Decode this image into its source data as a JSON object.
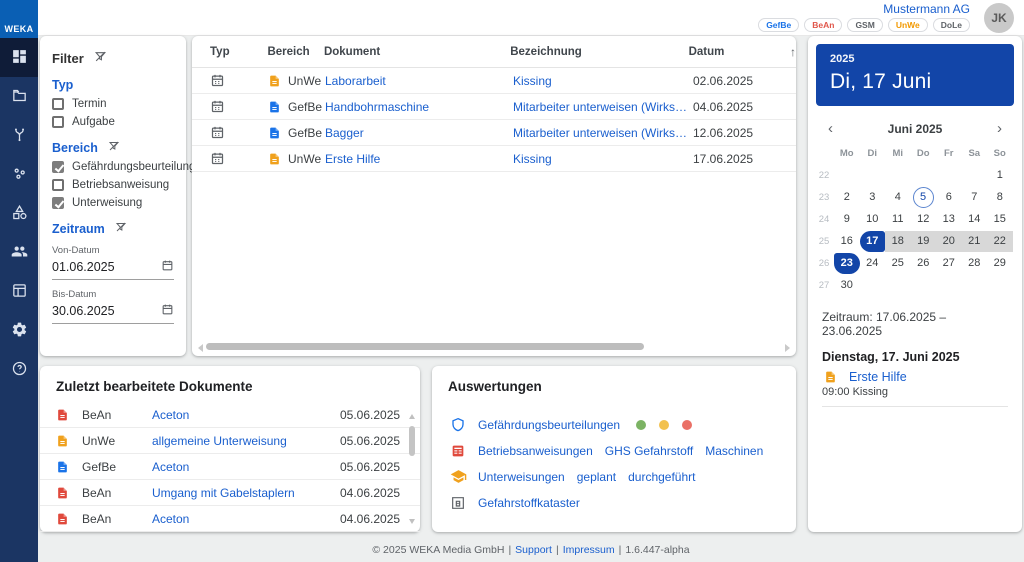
{
  "brand": {
    "logo_text": "WEKA"
  },
  "topbar": {
    "company": "Mustermann AG",
    "avatar_initials": "JK",
    "badges": [
      {
        "label": "GefBe",
        "color": "#1a73e8"
      },
      {
        "label": "BeAn",
        "color": "#e0564a"
      },
      {
        "label": "GSM",
        "color": "#5f6368"
      },
      {
        "label": "UnWe",
        "color": "#f29900"
      },
      {
        "label": "DoLe",
        "color": "#5f6368"
      }
    ]
  },
  "sidebar": {
    "icons": [
      "dashboard",
      "documents",
      "workflow",
      "substances",
      "categories",
      "team",
      "planner",
      "settings",
      "help"
    ],
    "active": "dashboard"
  },
  "filter": {
    "title": "Filter",
    "typ": {
      "label": "Typ",
      "options": [
        {
          "label": "Termin",
          "checked": false
        },
        {
          "label": "Aufgabe",
          "checked": false
        }
      ]
    },
    "bereich": {
      "label": "Bereich",
      "options": [
        {
          "label": "Gefährdungsbeurteilung",
          "checked": true
        },
        {
          "label": "Betriebsanweisung",
          "checked": false
        },
        {
          "label": "Unterweisung",
          "checked": true
        }
      ]
    },
    "zeitraum": {
      "label": "Zeitraum",
      "von_label": "Von-Datum",
      "von_value": "01.06.2025",
      "bis_label": "Bis-Datum",
      "bis_value": "30.06.2025"
    }
  },
  "doc_colors": {
    "UnWe": "#f0a11d",
    "GefBe": "#1a73e8",
    "BeAn": "#e0493c"
  },
  "table": {
    "headers": {
      "typ": "Typ",
      "bereich": "Bereich",
      "dokument": "Dokument",
      "bezeichnung": "Bezeichnung",
      "datum": "Datum"
    },
    "sort_icon": "↑",
    "rows": [
      {
        "typ": "termin",
        "bereich": "UnWe",
        "dokument": "Laborarbeit",
        "bezeichnung": "Kissing",
        "datum": "02.06.2025"
      },
      {
        "typ": "termin",
        "bereich": "GefBe",
        "dokument": "Handbohrmaschine",
        "bezeichnung": "Mitarbeiter unterweisen (Wirksam...",
        "datum": "04.06.2025"
      },
      {
        "typ": "termin",
        "bereich": "GefBe",
        "dokument": "Bagger",
        "bezeichnung": "Mitarbeiter unterweisen (Wirksam...",
        "datum": "12.06.2025"
      },
      {
        "typ": "termin",
        "bereich": "UnWe",
        "dokument": "Erste Hilfe",
        "bezeichnung": "Kissing",
        "datum": "17.06.2025"
      }
    ]
  },
  "calendar": {
    "year_label": "2025",
    "selected_date_label": "Di, 17 Juni",
    "month_label": "Juni 2025",
    "prev_icon": "‹",
    "next_icon": "›",
    "weekday_headers": [
      "Mo",
      "Di",
      "Mi",
      "Do",
      "Fr",
      "Sa",
      "So"
    ],
    "weeks": [
      {
        "num": 22,
        "days": [
          null,
          null,
          null,
          null,
          null,
          null,
          1
        ]
      },
      {
        "num": 23,
        "days": [
          2,
          3,
          4,
          {
            "d": 5,
            "state": "today"
          },
          6,
          7,
          8
        ]
      },
      {
        "num": 24,
        "days": [
          9,
          10,
          11,
          12,
          13,
          14,
          15
        ]
      },
      {
        "num": 25,
        "days": [
          16,
          {
            "d": 17,
            "state": "start"
          },
          {
            "d": 18,
            "state": "range"
          },
          {
            "d": 19,
            "state": "range"
          },
          {
            "d": 20,
            "state": "range"
          },
          {
            "d": 21,
            "state": "range"
          },
          {
            "d": 22,
            "state": "range"
          }
        ]
      },
      {
        "num": 26,
        "days": [
          {
            "d": 23,
            "state": "end"
          },
          24,
          25,
          26,
          27,
          28,
          29
        ]
      },
      {
        "num": 27,
        "days": [
          30,
          null,
          null,
          null,
          null,
          null,
          null
        ]
      }
    ],
    "zeitraum_label": "Zeitraum: 17.06.2025 – 23.06.2025",
    "day_detail": {
      "title": "Dienstag, 17. Juni 2025",
      "event_type": "UnWe",
      "event_link": "Erste Hilfe",
      "event_time_location": "09:00 Kissing"
    }
  },
  "recent": {
    "title": "Zuletzt bearbeitete Dokumente",
    "rows": [
      {
        "type": "BeAn",
        "dokument": "Aceton",
        "datum": "05.06.2025"
      },
      {
        "type": "UnWe",
        "dokument": "allgemeine Unterweisung",
        "datum": "05.06.2025"
      },
      {
        "type": "GefBe",
        "dokument": "Aceton",
        "datum": "05.06.2025"
      },
      {
        "type": "BeAn",
        "dokument": "Umgang mit Gabelstaplern",
        "datum": "04.06.2025"
      },
      {
        "type": "BeAn",
        "dokument": "Aceton",
        "datum": "04.06.2025"
      }
    ]
  },
  "auswertungen": {
    "title": "Auswertungen",
    "rows": [
      {
        "icon": "shield-icon",
        "links": [
          "Gefährdungsbeurteilungen"
        ],
        "status_dots": [
          "#7cb364",
          "#f2c14e",
          "#ea7066"
        ]
      },
      {
        "icon": "table-doc-icon",
        "links": [
          "Betriebsanweisungen",
          "GHS Gefahrstoff",
          "Maschinen"
        ]
      },
      {
        "icon": "graduation-cap-icon",
        "links": [
          "Unterweisungen",
          "geplant",
          "durchgeführt"
        ]
      },
      {
        "icon": "cabinet-icon",
        "links": [
          "Gefahrstoffkataster"
        ]
      }
    ]
  },
  "footer": {
    "copyright": "© 2025 WEKA Media GmbH",
    "separator": "|",
    "support": "Support",
    "impressum": "Impressum",
    "version": "1.6.447-alpha"
  }
}
